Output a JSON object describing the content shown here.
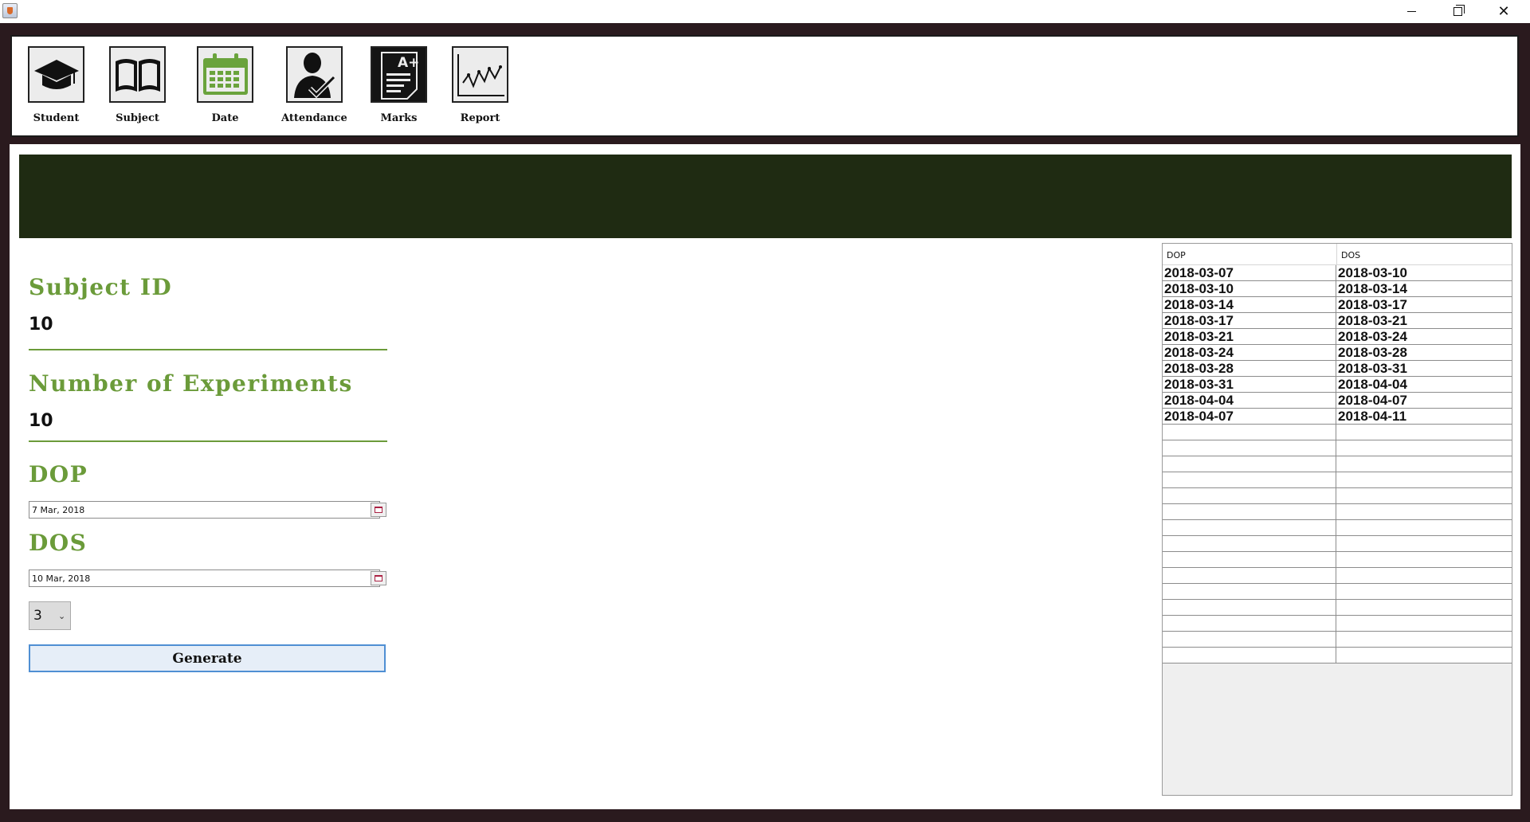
{
  "window": {
    "controls": {
      "minimize": "minimize",
      "maximize": "maximize",
      "close": "close"
    }
  },
  "toolbar": {
    "items": [
      {
        "label": "Student",
        "icon": "graduation-cap-icon"
      },
      {
        "label": "Subject",
        "icon": "book-icon"
      },
      {
        "label": "Date",
        "icon": "calendar-icon"
      },
      {
        "label": "Attendance",
        "icon": "person-check-icon"
      },
      {
        "label": "Marks",
        "icon": "marks-sheet-icon"
      },
      {
        "label": "Report",
        "icon": "line-chart-icon"
      }
    ]
  },
  "colors": {
    "banner": "#1f2b12",
    "label_green": "#6b9b3a",
    "calendar_green": "#6aa33c",
    "button_border": "#4f8fd3"
  },
  "form": {
    "subject_id": {
      "label": "Subject ID",
      "value": "10"
    },
    "experiments": {
      "label": "Number of Experiments",
      "value": "10"
    },
    "dop": {
      "label": "DOP",
      "value": "7 Mar, 2018"
    },
    "dos": {
      "label": "DOS",
      "value": "10 Mar, 2018"
    },
    "interval": {
      "selected": "3"
    },
    "generate_label": "Generate"
  },
  "table": {
    "headers": [
      "DOP",
      "DOS"
    ],
    "rows": [
      [
        "2018-03-07",
        "2018-03-10"
      ],
      [
        "2018-03-10",
        "2018-03-14"
      ],
      [
        "2018-03-14",
        "2018-03-17"
      ],
      [
        "2018-03-17",
        "2018-03-21"
      ],
      [
        "2018-03-21",
        "2018-03-24"
      ],
      [
        "2018-03-24",
        "2018-03-28"
      ],
      [
        "2018-03-28",
        "2018-03-31"
      ],
      [
        "2018-03-31",
        "2018-04-04"
      ],
      [
        "2018-04-04",
        "2018-04-07"
      ],
      [
        "2018-04-07",
        "2018-04-11"
      ],
      [
        "",
        ""
      ],
      [
        "",
        ""
      ],
      [
        "",
        ""
      ],
      [
        "",
        ""
      ],
      [
        "",
        ""
      ],
      [
        "",
        ""
      ],
      [
        "",
        ""
      ],
      [
        "",
        ""
      ],
      [
        "",
        ""
      ],
      [
        "",
        ""
      ],
      [
        "",
        ""
      ],
      [
        "",
        ""
      ],
      [
        "",
        ""
      ],
      [
        "",
        ""
      ],
      [
        "",
        ""
      ]
    ]
  }
}
